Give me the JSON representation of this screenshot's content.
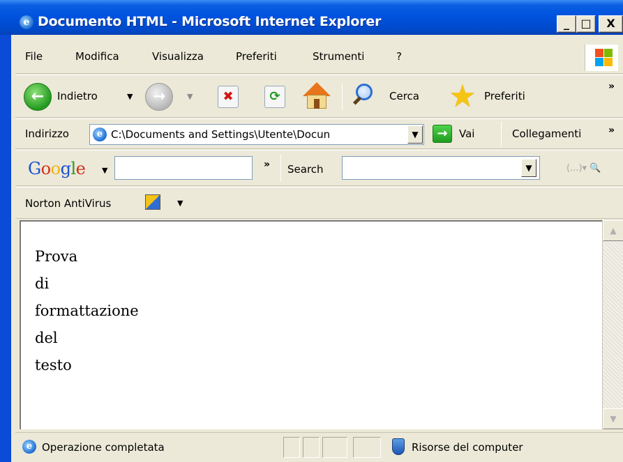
{
  "window": {
    "title": "Documento HTML - Microsoft Internet Explorer",
    "minimize": "_",
    "maximize": "□",
    "close": "X"
  },
  "menu": [
    "File",
    "Modifica",
    "Visualizza",
    "Preferiti",
    "Strumenti",
    "?"
  ],
  "toolbar": {
    "back_label": "Indietro",
    "search_label": "Cerca",
    "favorites_label": "Preferiti",
    "more": "»"
  },
  "address": {
    "label": "Indirizzo",
    "value": "C:\\Documents and Settings\\Utente\\Docun",
    "go_label": "Vai",
    "links_label": "Collegamenti",
    "more": "»"
  },
  "google": {
    "logo": "Google",
    "more": "»",
    "search_label": "Search",
    "query": "",
    "tools": "(...)▾ 🔍"
  },
  "norton": {
    "label": "Norton AntiVirus"
  },
  "content": {
    "lines": [
      "Prova",
      "di",
      "formattazione",
      "del",
      "testo"
    ]
  },
  "status": {
    "text": "Operazione completata",
    "zone": "Risorse del computer"
  }
}
